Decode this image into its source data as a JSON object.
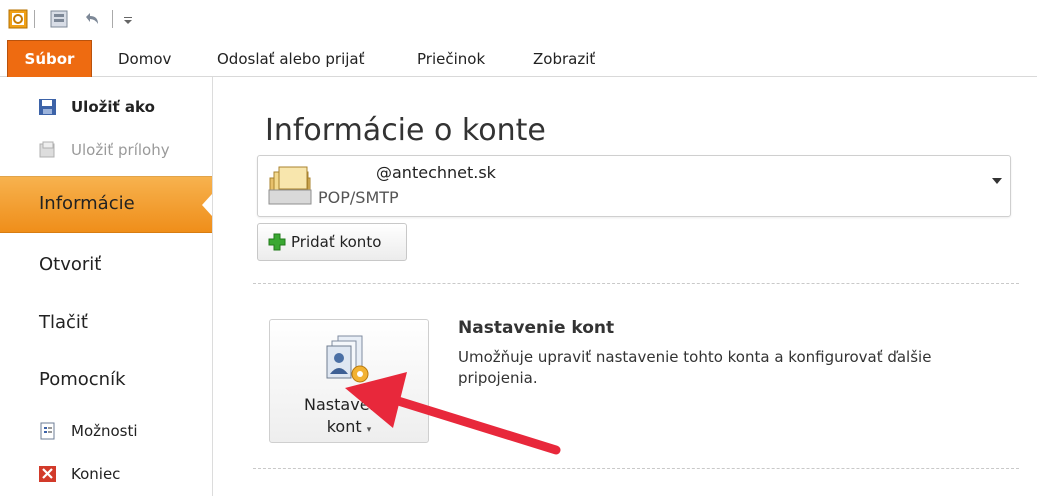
{
  "ribbon": {
    "tabs": [
      "Súbor",
      "Domov",
      "Odoslať alebo prijať",
      "Priečinok",
      "Zobraziť"
    ]
  },
  "backstage": {
    "save_as": "Uložiť ako",
    "save_attachments": "Uložiť prílohy",
    "info": "Informácie",
    "open": "Otvoriť",
    "print": "Tlačiť",
    "help": "Pomocník",
    "options": "Možnosti",
    "exit": "Koniec"
  },
  "main": {
    "title": "Informácie o konte",
    "account": {
      "email": "@antechnet.sk",
      "type": "POP/SMTP"
    },
    "add_account": "Pridať konto",
    "account_settings": {
      "button_line1": "Nastavenie",
      "button_line2": "kont",
      "title": "Nastavenie kont",
      "description": "Umožňuje upraviť nastavenie tohto konta a konfigurovať ďalšie pripojenia."
    }
  },
  "colors": {
    "accent": "#ee6b11",
    "nav_active": "#f2a23a",
    "arrow": "#e8283b"
  }
}
